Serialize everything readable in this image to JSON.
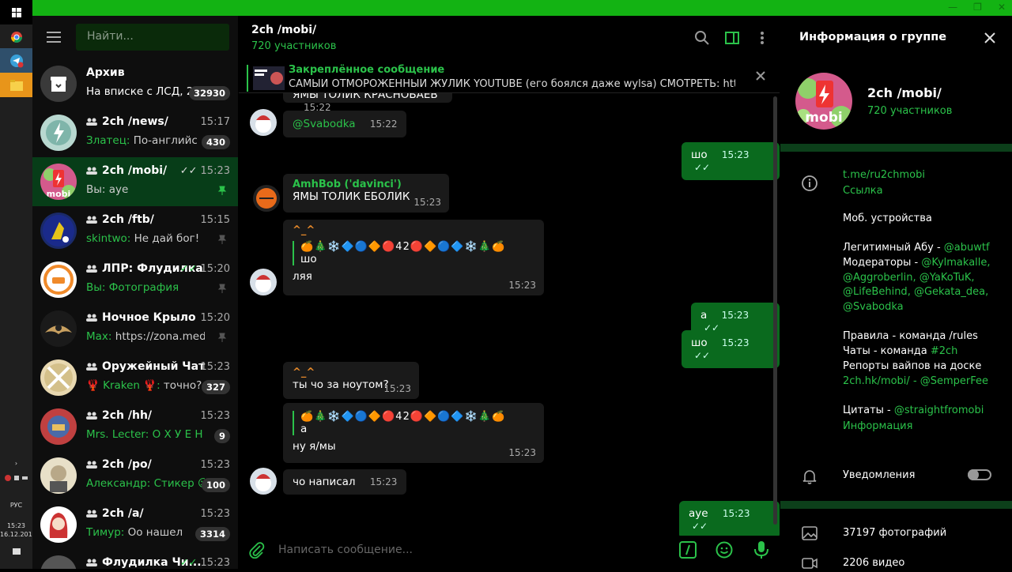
{
  "sidebar": {
    "search_placeholder": "Найти...",
    "chats": [
      {
        "title": "Архив",
        "time": "",
        "sender": "",
        "preview": "На вписке с ЛСД, 2с...",
        "badge": "32930"
      },
      {
        "title": "2ch /news/",
        "time": "15:17",
        "sender": "Златец:",
        "preview": "По-английски...",
        "badge": "430"
      },
      {
        "title": "2ch /mobi/",
        "time": "15:23",
        "sender": "",
        "preview": "Вы: aye",
        "badge": ""
      },
      {
        "title": "2ch /ftb/",
        "time": "15:15",
        "sender": "skintwo:",
        "preview": "Не дай бог!",
        "badge": ""
      },
      {
        "title": "ЛПР: Флудилка",
        "time": "15:20",
        "sender": "Вы:",
        "preview": "Фотография",
        "badge": ""
      },
      {
        "title": "Ночное Крыло",
        "time": "15:20",
        "sender": "Max:",
        "preview": "https://zona.media...",
        "badge": ""
      },
      {
        "title": "Оружейный Чат",
        "time": "15:23",
        "sender": "🦞 Kraken 🦞:",
        "preview": "точно?",
        "badge": "327"
      },
      {
        "title": "2ch /hh/",
        "time": "15:23",
        "sender": "Mrs. Lecter:",
        "preview": "О Х У Е Н Н О",
        "badge": "9"
      },
      {
        "title": "2ch /po/",
        "time": "15:23",
        "sender": "Александр:",
        "preview": "Стикер ☺",
        "badge": "100"
      },
      {
        "title": "2ch /a/",
        "time": "15:23",
        "sender": "Тимур:",
        "preview": "Оо нашел",
        "badge": "3314"
      },
      {
        "title": "Флудилка Чи...",
        "time": "15:23",
        "sender": "",
        "preview": "",
        "badge": ""
      }
    ]
  },
  "chat": {
    "title": "2ch /mobi/",
    "subtitle": "720 участников",
    "pinned_label": "Закреплённое сообщение",
    "pinned_text": "САМЫЙ ОТМОРОЖЕННЫЙ ЖУЛИК YOUTUBE (его боялся даже wylsa)  СМОТРЕТЬ: https://y...",
    "composer_placeholder": "Написать сообщение...",
    "messages": {
      "m0_text": "ЯМЫ ТОЛИК КРАСНОБАЕВ",
      "m0_time": "15:22",
      "m1_text": "@Svabodka",
      "m1_time": "15:22",
      "m2_text": "шо",
      "m2_time": "15:23",
      "m3_name": "AmhBob ('davinci')",
      "m3_text": "ЯМЫ ТОЛИК ЕБОЛИК",
      "m3_time": "15:23",
      "m4_name": "^_^",
      "m4_quote_head": "🍊🎄❄️🔷🔵🔶🔴42🔴🔶🔵🔷❄️🎄🍊",
      "m4_quote": "шо",
      "m4_text": "ляя",
      "m4_time": "15:23",
      "m5_text": "а",
      "m5_time": "15:23",
      "m6_text": "шо",
      "m6_time": "15:23",
      "m7_name": "^_^",
      "m7_text": "ты чо за ноутом?",
      "m7_time": "15:23",
      "m8_quote_head": "🍊🎄❄️🔷🔵🔶🔴42🔴🔶🔵🔷❄️🎄🍊",
      "m8_quote": "а",
      "m8_text": "ну я/мы",
      "m8_time": "15:23",
      "m9_text": "чо написал",
      "m9_time": "15:23",
      "m10_text": "ауе",
      "m10_time": "15:23"
    }
  },
  "info": {
    "header": "Информация о группе",
    "name": "2ch /mobi/",
    "members": "720 участников",
    "link": "t.me/ru2chmobi",
    "link_label": "Ссылка",
    "desc1": "Моб. устройства",
    "desc2a": "Легитимный Абу - ",
    "desc2b": "@abuwtf",
    "desc3a": "Модераторы - ",
    "desc3b": "@Kylmakalle,",
    "desc4": "@Aggroberlin, @YaKoTuK,",
    "desc5": "@LifeBehind, @Gekata_dea,",
    "desc6": "@Svabodka",
    "desc7": "Правила - команда /rules",
    "desc8a": "Чаты - команда ",
    "desc8b": "#2ch",
    "desc9": "Репорты вайпов на доске",
    "desc10a": "2ch.hk/mobi/",
    "desc10b": " - @SemperFee",
    "desc11a": "Цитаты - ",
    "desc11b": "@straightfromobi",
    "desc12": "Информация",
    "notifications": "Уведомления",
    "photos": "37197 фотографий",
    "videos": "2206 видео"
  },
  "taskbar": {
    "lang": "РУС",
    "time": "15:23",
    "date": "16.12.2019"
  },
  "colors": {
    "accent": "#2bc24a",
    "titlebar": "#13b313",
    "active_chat": "#073d18",
    "out_bubble": "#0a6a1e"
  }
}
